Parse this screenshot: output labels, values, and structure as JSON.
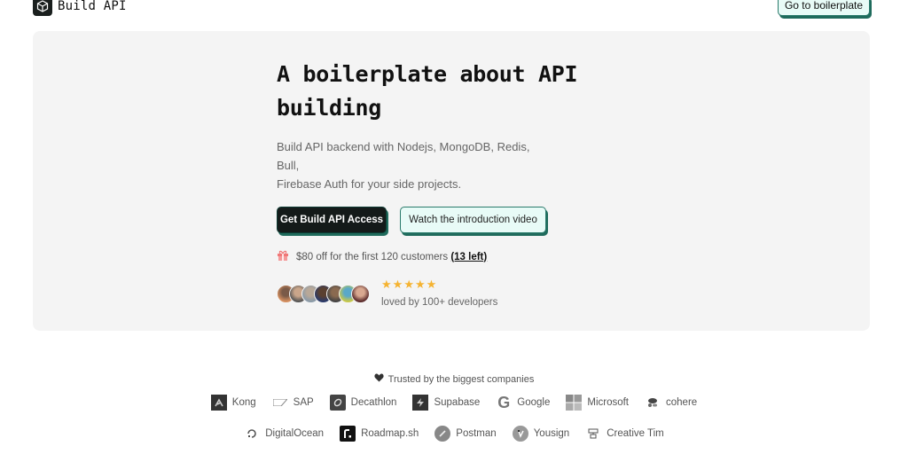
{
  "header": {
    "logo_text": "Build API",
    "cta_label": "Go to boilerplate"
  },
  "hero": {
    "title_line1": "A boilerplate about API",
    "title_line2": "building",
    "subtitle_line1": "Build API backend with Nodejs, MongoDB, Redis, Bull,",
    "subtitle_line2": "Firebase Auth for your side projects.",
    "primary_button": "Get Build API Access",
    "secondary_button": "Watch the introduction video",
    "offer_text": "$80 off for the first 120 customers",
    "offer_link": "(13 left)",
    "rating_stars": 5,
    "loved_text": "loved by 100+ developers",
    "avatar_count": 7
  },
  "trusted": {
    "label": "Trusted by the biggest companies",
    "row1": [
      "Kong",
      "SAP",
      "Decathlon",
      "Supabase",
      "Google",
      "Microsoft",
      "cohere"
    ],
    "row2": [
      "DigitalOcean",
      "Roadmap.sh",
      "Postman",
      "Yousign",
      "Creative Tim"
    ]
  },
  "colors": {
    "accent": "#1f6b5c",
    "accent_bg": "#e8fbf7",
    "dark": "#141a19",
    "star": "#f5b331",
    "hero_bg": "#f4f4f4"
  }
}
